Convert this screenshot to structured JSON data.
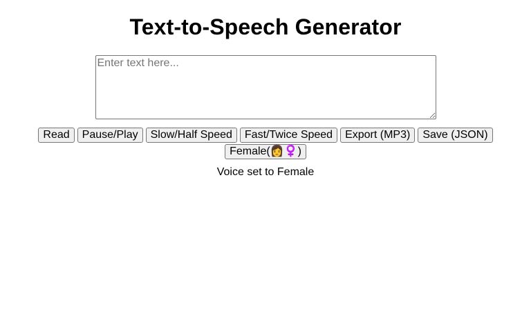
{
  "header": {
    "title": "Text-to-Speech Generator"
  },
  "input": {
    "placeholder": "Enter text here...",
    "value": ""
  },
  "controls": {
    "read_label": "Read",
    "pause_play_label": "Pause/Play",
    "slow_label": "Slow/Half Speed",
    "fast_label": "Fast/Twice Speed",
    "export_label": "Export (MP3)",
    "save_label": "Save (JSON)",
    "voice_label": "Female(👩‍♀)"
  },
  "status": {
    "message": "Voice set to Female"
  }
}
